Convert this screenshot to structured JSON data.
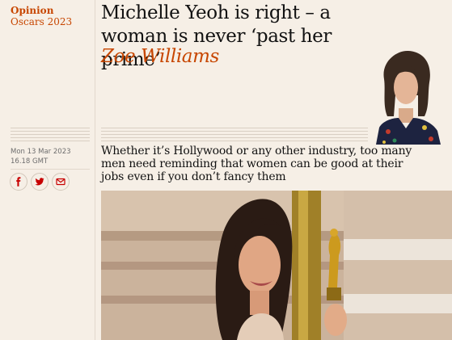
{
  "section": {
    "label": "Opinion",
    "series": "Oscars 2023"
  },
  "article": {
    "headline": "Michelle Yeoh is right – a woman is never ‘past her prime’",
    "byline": "Zoe Williams",
    "dateline": "Mon 13 Mar 2023 16.18 GMT",
    "standfirst": "Whether it’s Hollywood or any other industry, too many men need reminding that women can be good at their jobs even if you don’t fancy them"
  },
  "share": [
    {
      "icon": "facebook-icon"
    },
    {
      "icon": "twitter-icon"
    },
    {
      "icon": "email-icon"
    }
  ],
  "colors": {
    "accent": "#c74600",
    "background": "#f6efe6",
    "text": "#121212"
  }
}
